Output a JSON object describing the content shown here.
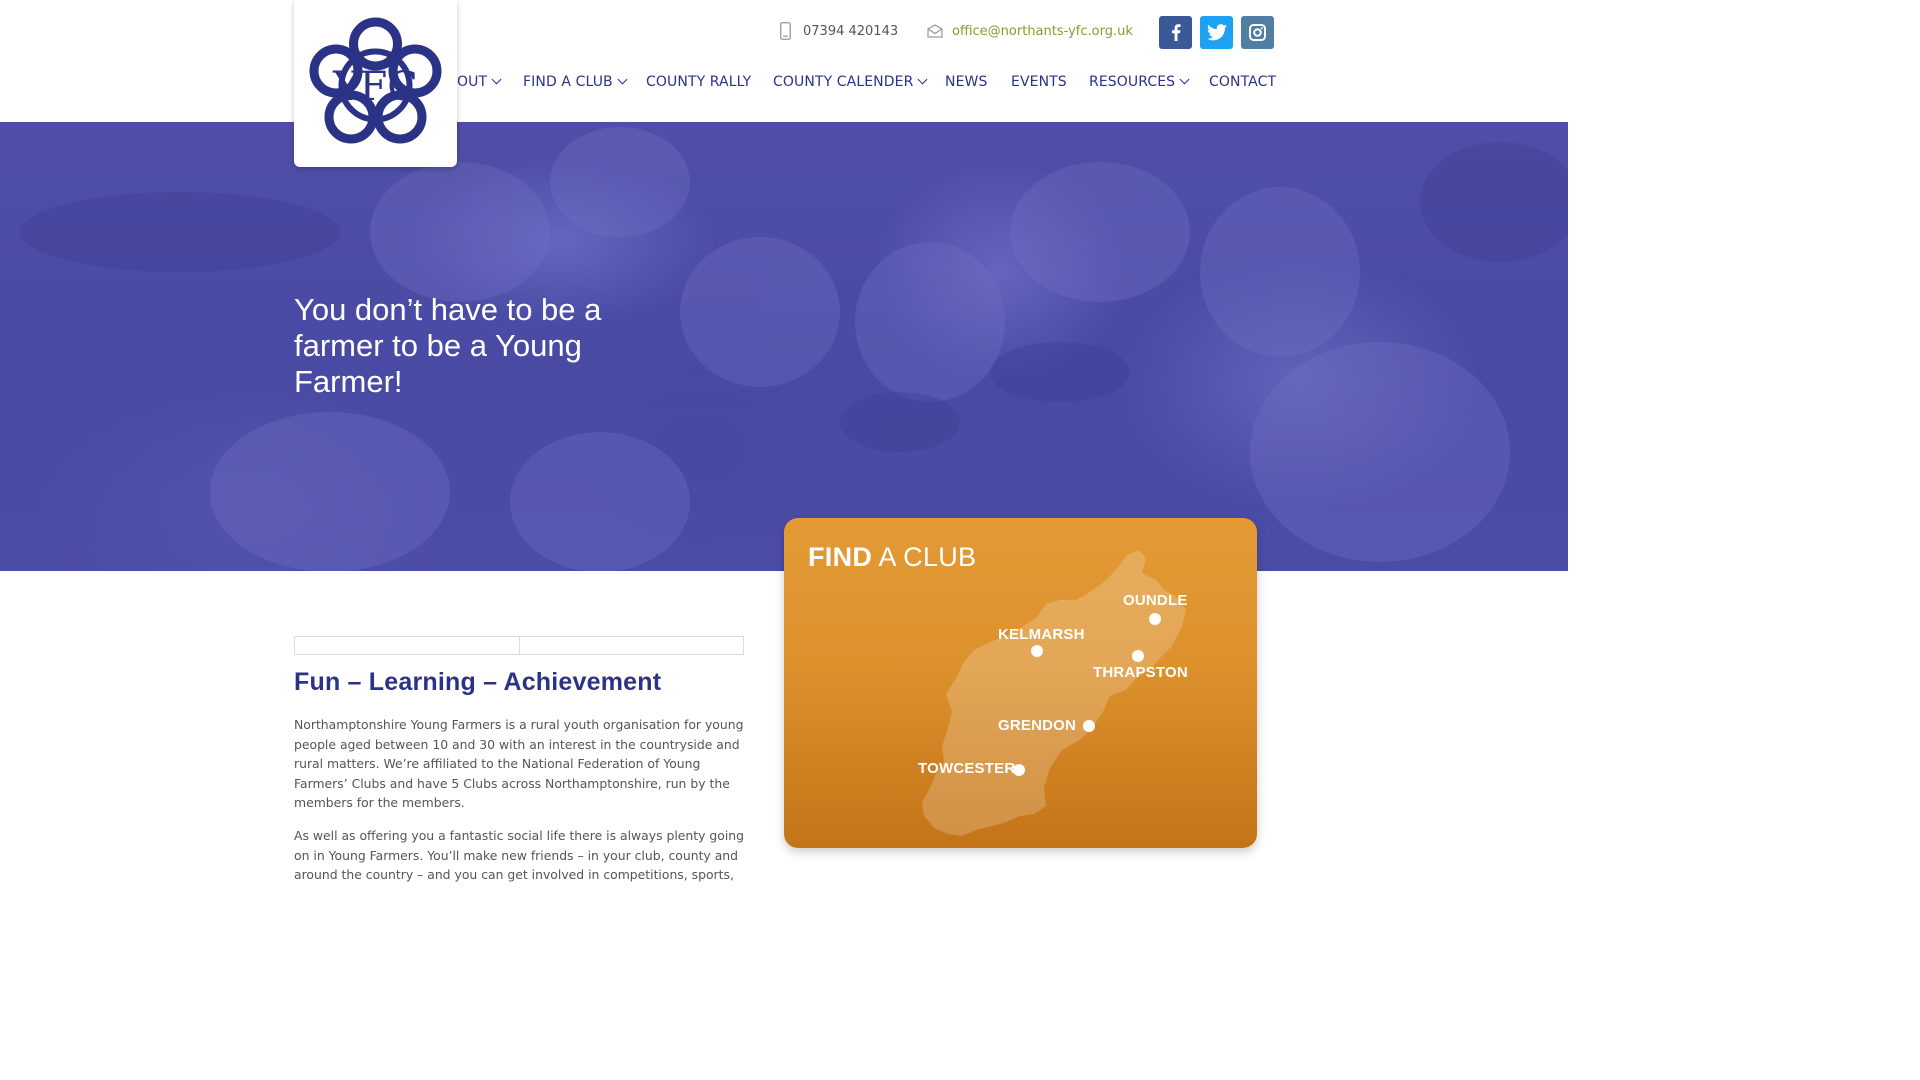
{
  "header": {
    "logo_text": "YFC",
    "phone": "07394 420143",
    "email": "office@northants-yfc.org.uk",
    "social": [
      {
        "name": "facebook",
        "icon": "facebook-icon",
        "color": "#3b5998"
      },
      {
        "name": "twitter",
        "icon": "twitter-icon",
        "color": "#1da1f2"
      },
      {
        "name": "instagram",
        "icon": "instagram-icon",
        "color": "#517fa4"
      }
    ],
    "nav": [
      {
        "label": "OUT",
        "has_dropdown": true
      },
      {
        "label": "FIND A CLUB",
        "has_dropdown": true
      },
      {
        "label": "COUNTY RALLY",
        "has_dropdown": false
      },
      {
        "label": "COUNTY CALENDER",
        "has_dropdown": true
      },
      {
        "label": "NEWS",
        "has_dropdown": false
      },
      {
        "label": "EVENTS",
        "has_dropdown": false
      },
      {
        "label": "RESOURCES",
        "has_dropdown": true
      },
      {
        "label": "CONTACT",
        "has_dropdown": false
      }
    ]
  },
  "hero": {
    "title": "You don’t have to be a farmer to be a Young Farmer!"
  },
  "find_club": {
    "title_bold": "FIND",
    "title_rest": " A CLUB",
    "towns": [
      "OUNDLE",
      "KELMARSH",
      "THRAPSTON",
      "GRENDON",
      "TOWCESTER"
    ]
  },
  "content": {
    "heading": "Fun – Learning – Achievement",
    "paragraph1": "Northamptonshire Young Farmers is a rural youth organisation for young people aged between 10 and 30 with an interest in the countryside and rural matters.  We’re affiliated to the National Federation of Young Farmers’ Clubs and have 5 Clubs across Northamptonshire, run by the members for the members.",
    "paragraph2": "As well as offering you a fantastic social life there is always plenty going on in Young Farmers.  You’ll make new friends – in your club, county and around the country – and you can get involved in competitions, sports,"
  },
  "colors": {
    "brand_blue": "#2b3387",
    "hero_overlay": "#4b4ca6",
    "card_orange": "#e0962f",
    "email_green": "#8c9a2e"
  }
}
